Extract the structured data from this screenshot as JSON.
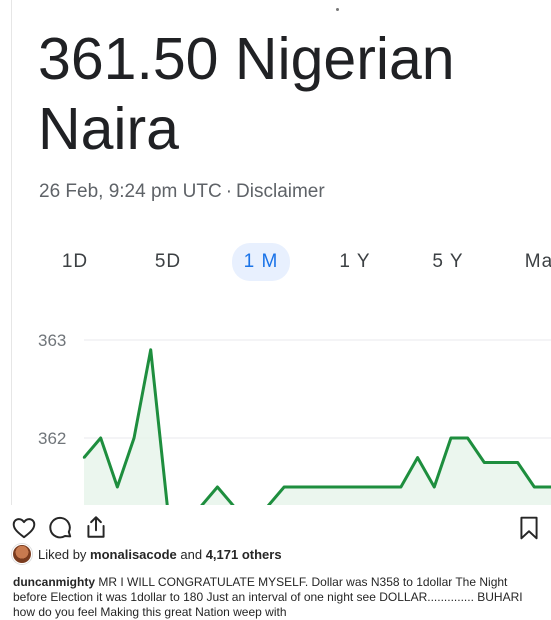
{
  "post": {
    "title": "361.50 Nigerian Naira",
    "timestamp": "26 Feb, 9:24 pm UTC",
    "separator": "·",
    "disclaimer": "Disclaimer"
  },
  "tabs": [
    {
      "label": "1D",
      "active": false
    },
    {
      "label": "5D",
      "active": false
    },
    {
      "label": "1 M",
      "active": true
    },
    {
      "label": "1 Y",
      "active": false
    },
    {
      "label": "5 Y",
      "active": false
    },
    {
      "label": "Ma",
      "active": false
    }
  ],
  "chart_data": {
    "type": "area",
    "y_ticks": [
      "363",
      "362"
    ],
    "ylim": [
      361.3,
      363.3
    ],
    "x": [
      0,
      1,
      2,
      3,
      4,
      5,
      6,
      7,
      8,
      9,
      10,
      11,
      12,
      13,
      14,
      15,
      16,
      17,
      18,
      19,
      20,
      21,
      22,
      23,
      24,
      25,
      26,
      27,
      28
    ],
    "values": [
      361.8,
      362.0,
      361.5,
      362.0,
      362.9,
      361.3,
      361.3,
      361.3,
      361.5,
      361.3,
      361.3,
      361.3,
      361.5,
      361.5,
      361.5,
      361.5,
      361.5,
      361.5,
      361.5,
      361.5,
      361.8,
      361.5,
      362.0,
      362.0,
      361.75,
      361.75,
      361.75,
      361.5,
      361.5
    ],
    "grid": true,
    "line_color": "#1e8e3e",
    "fill_color": "#e6f4ea"
  },
  "actions": {
    "liked_by_prefix": "Liked by",
    "liked_by_user": "monalisacode",
    "liked_by_and": "and",
    "liked_by_count": "4,171 others"
  },
  "caption": {
    "username": "duncanmighty",
    "text": "MR I WILL CONGRATULATE MYSELF. Dollar was N358 to 1dollar The Night before Election it was 1dollar to 180 Just an interval of one night see DOLLAR.............. BUHARI how do you feel Making this great Nation weep with"
  },
  "icons": {
    "like": "heart-icon",
    "comment": "comment-icon",
    "share": "share-icon",
    "save": "bookmark-icon"
  }
}
